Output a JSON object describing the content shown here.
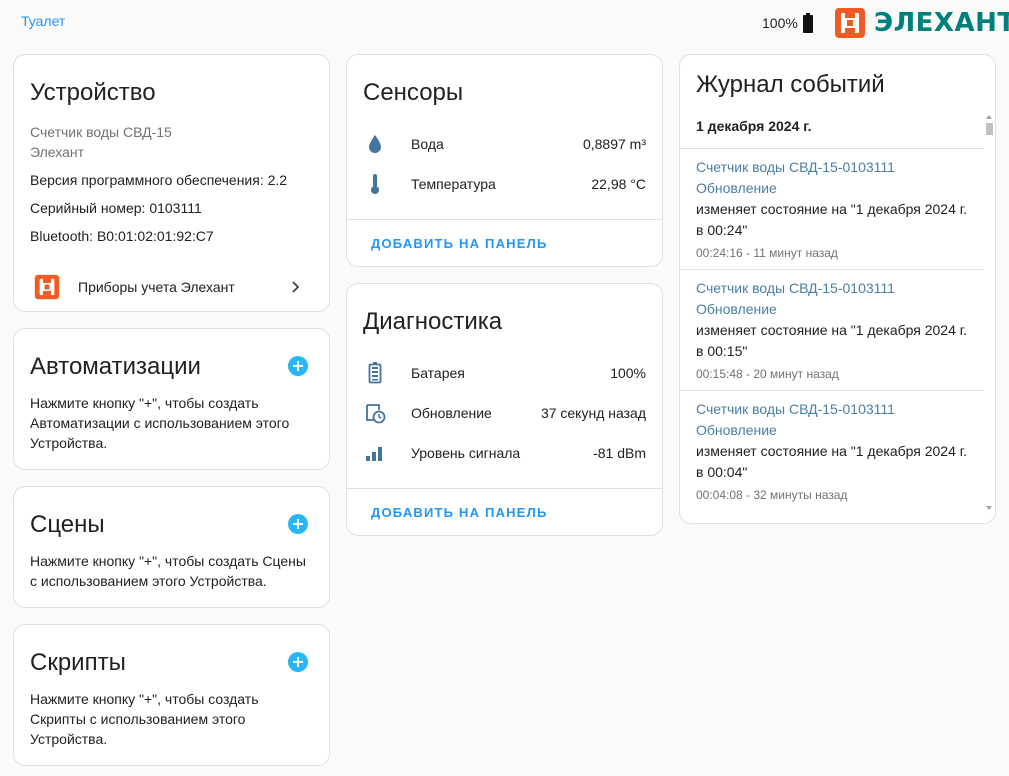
{
  "header": {
    "breadcrumb": "Туалет",
    "battery_level": "100%",
    "logo_text": "ЭЛЕХАНТ"
  },
  "device": {
    "title": "Устройство",
    "model": "Счетчик воды СВД-15",
    "manufacturer": "Элехант",
    "firmware": "Версия программного обеспечения: 2.2",
    "serial": "Серийный номер: 0103111",
    "bluetooth": "Bluetooth: B0:01:02:01:92:C7",
    "integration_label": "Приборы учета Элехант"
  },
  "automations": {
    "title": "Автоматизации",
    "description": "Нажмите кнопку \"+\", чтобы создать Автоматизации с использованием этого Устройства."
  },
  "scenes": {
    "title": "Сцены",
    "description": "Нажмите кнопку \"+\", чтобы создать Сцены с использованием этого Устройства."
  },
  "scripts": {
    "title": "Скрипты",
    "description": "Нажмите кнопку \"+\", чтобы создать Скрипты с использованием этого Устройства."
  },
  "sensors": {
    "title": "Сенсоры",
    "rows": [
      {
        "icon": "water-drop-icon",
        "label": "Вода",
        "value": "0,8897 m³"
      },
      {
        "icon": "thermometer-icon",
        "label": "Температура",
        "value": "22,98 °C"
      }
    ],
    "add_label": "ДОБАВИТЬ НА ПАНЕЛЬ"
  },
  "diagnostics": {
    "title": "Диагностика",
    "rows": [
      {
        "icon": "battery-icon",
        "label": "Батарея",
        "value": "100%"
      },
      {
        "icon": "clock-update-icon",
        "label": "Обновление",
        "value": "37 секунд назад"
      },
      {
        "icon": "signal-icon",
        "label": "Уровень сигнала",
        "value": "-81 dBm"
      }
    ],
    "add_label": "ДОБАВИТЬ НА ПАНЕЛЬ"
  },
  "logbook": {
    "title": "Журнал событий",
    "date": "1 декабря 2024 г.",
    "entries": [
      {
        "entity": "Счетчик воды СВД-15-0103111 Обновление",
        "message": "изменяет состояние на \"1 декабря 2024 г. в 00:24\"",
        "time": "00:24:16 - 11 минут назад"
      },
      {
        "entity": "Счетчик воды СВД-15-0103111 Обновление",
        "message": "изменяет состояние на \"1 декабря 2024 г. в 00:15\"",
        "time": "00:15:48 - 20 минут назад"
      },
      {
        "entity": "Счетчик воды СВД-15-0103111 Обновление",
        "message": "изменяет состояние на \"1 декабря 2024 г. в 00:04\"",
        "time": "00:04:08 - 32 минуты назад"
      }
    ]
  },
  "colors": {
    "accent": "#2196f3",
    "plus": "#29b6f6",
    "logo_orange": "#f15a24",
    "logo_teal": "#00807a",
    "icon_blue": "#44739e"
  }
}
